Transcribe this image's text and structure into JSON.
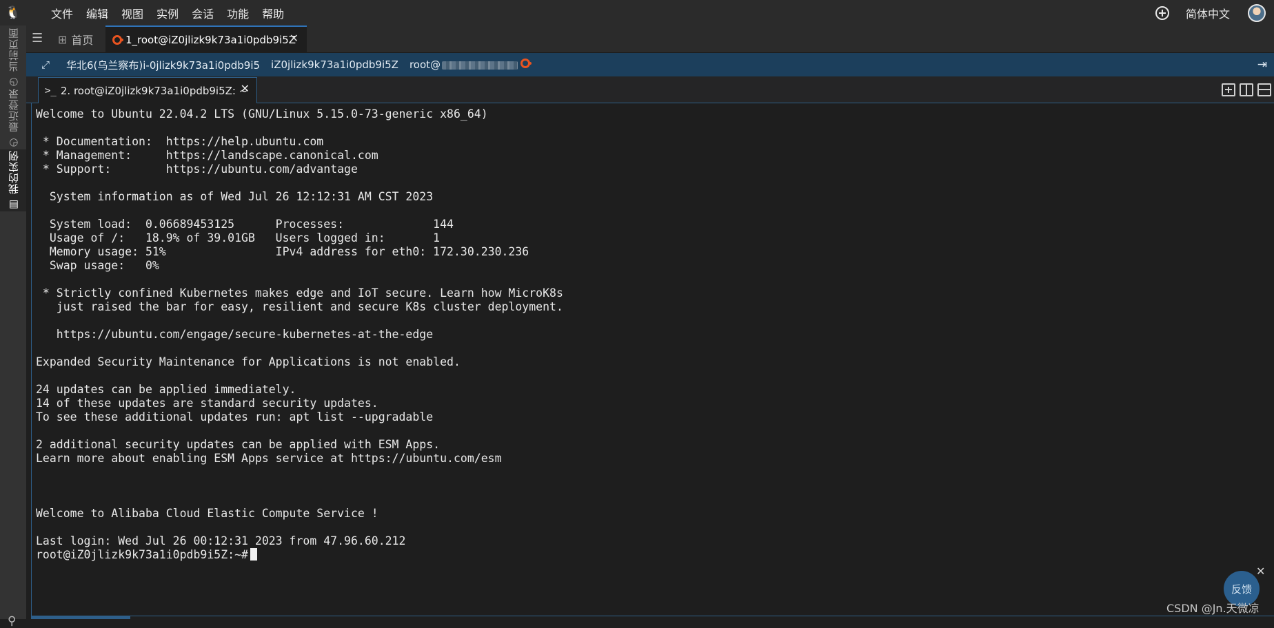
{
  "menubar": {
    "items": [
      "文件",
      "编辑",
      "视图",
      "实例",
      "会话",
      "功能",
      "帮助"
    ],
    "language": "简体中文",
    "icons": {
      "app": "tux-icon",
      "new": "plus-circle-icon",
      "avatar": "user-avatar"
    }
  },
  "sidebar": {
    "tabs": [
      {
        "label": "当前页面",
        "icon": "clock-icon"
      },
      {
        "label": "最近登录",
        "icon": "history-icon"
      },
      {
        "label": "我的实例",
        "icon": "list-icon"
      }
    ],
    "active": "我的实例"
  },
  "tabbar": {
    "home_label": "首页",
    "session_tab_label": "1_root@iZ0jlizk9k73a1i0pdb9i5Z"
  },
  "infobar": {
    "region": "华北6(乌兰察布)i-0jlizk9k73a1i0pdb9i5",
    "hostname": "iZ0jlizk9k73a1i0pdb9i5Z",
    "user_prefix": "root@"
  },
  "terminal_tab": {
    "label": "2. root@iZ0jlizk9k73a1i0pdb9i5Z: ~"
  },
  "terminal": {
    "lines": [
      "Welcome to Ubuntu 22.04.2 LTS (GNU/Linux 5.15.0-73-generic x86_64)",
      "",
      " * Documentation:  https://help.ubuntu.com",
      " * Management:     https://landscape.canonical.com",
      " * Support:        https://ubuntu.com/advantage",
      "",
      "  System information as of Wed Jul 26 12:12:31 AM CST 2023",
      "",
      "  System load:  0.06689453125      Processes:             144",
      "  Usage of /:   18.9% of 39.01GB   Users logged in:       1",
      "  Memory usage: 51%                IPv4 address for eth0: 172.30.230.236",
      "  Swap usage:   0%",
      "",
      " * Strictly confined Kubernetes makes edge and IoT secure. Learn how MicroK8s",
      "   just raised the bar for easy, resilient and secure K8s cluster deployment.",
      "",
      "   https://ubuntu.com/engage/secure-kubernetes-at-the-edge",
      "",
      "Expanded Security Maintenance for Applications is not enabled.",
      "",
      "24 updates can be applied immediately.",
      "14 of these updates are standard security updates.",
      "To see these additional updates run: apt list --upgradable",
      "",
      "2 additional security updates can be applied with ESM Apps.",
      "Learn more about enabling ESM Apps service at https://ubuntu.com/esm",
      "",
      "",
      "",
      "Welcome to Alibaba Cloud Elastic Compute Service !",
      "",
      "Last login: Wed Jul 26 00:12:31 2023 from 47.96.60.212"
    ],
    "prompt": "root@iZ0jlizk9k73a1i0pdb9i5Z:~#"
  },
  "feedback": {
    "label": "反馈"
  },
  "watermark": "CSDN @Jn.天微凉",
  "colors": {
    "accent": "#2e5f8a",
    "infobar": "#1c3f5c",
    "terminal_bg": "#1e1e1e"
  }
}
